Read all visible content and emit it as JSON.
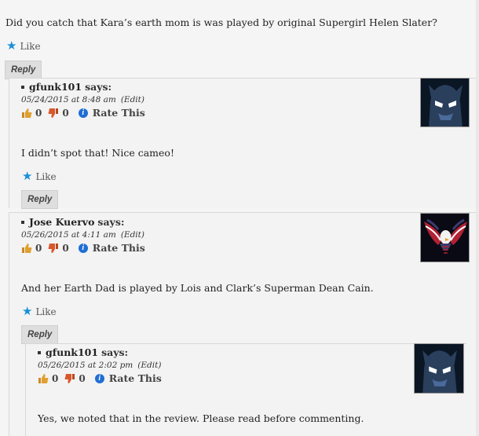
{
  "top_comment": {
    "text": "Did you catch that Kara’s earth mom is was played by original Supergirl Helen Slater?",
    "like_label": "Like",
    "reply_label": "Reply"
  },
  "comments": [
    {
      "author": "gfunk101",
      "says": "says:",
      "date": "05/24/2015 at 8:48 am",
      "edit": "(Edit)",
      "up_count": "0",
      "down_count": "0",
      "rate_label": "Rate This",
      "text": "I didn’t spot that! Nice cameo!",
      "like_label": "Like",
      "reply_label": "Reply",
      "avatar": "batman-avatar"
    },
    {
      "author": "Jose Kuervo",
      "says": "says:",
      "date": "05/26/2015 at 4:11 am",
      "edit": "(Edit)",
      "up_count": "0",
      "down_count": "0",
      "rate_label": "Rate This",
      "text": "And her Earth Dad is played by Lois and Clark’s Superman Dean Cain.",
      "like_label": "Like",
      "reply_label": "Reply",
      "avatar": "eagle-flag-avatar"
    },
    {
      "author": "gfunk101",
      "says": "says:",
      "date": "05/26/2015 at 2:02 pm",
      "edit": "(Edit)",
      "up_count": "0",
      "down_count": "0",
      "rate_label": "Rate This",
      "text": "Yes, we noted that in the review. Please read before commenting.",
      "avatar": "batman-avatar"
    }
  ],
  "colors": {
    "like_star": "#1a8fd6",
    "info_icon": "#1f6ed4",
    "thumb_up": "#e0a030",
    "thumb_down": "#d9582b"
  }
}
